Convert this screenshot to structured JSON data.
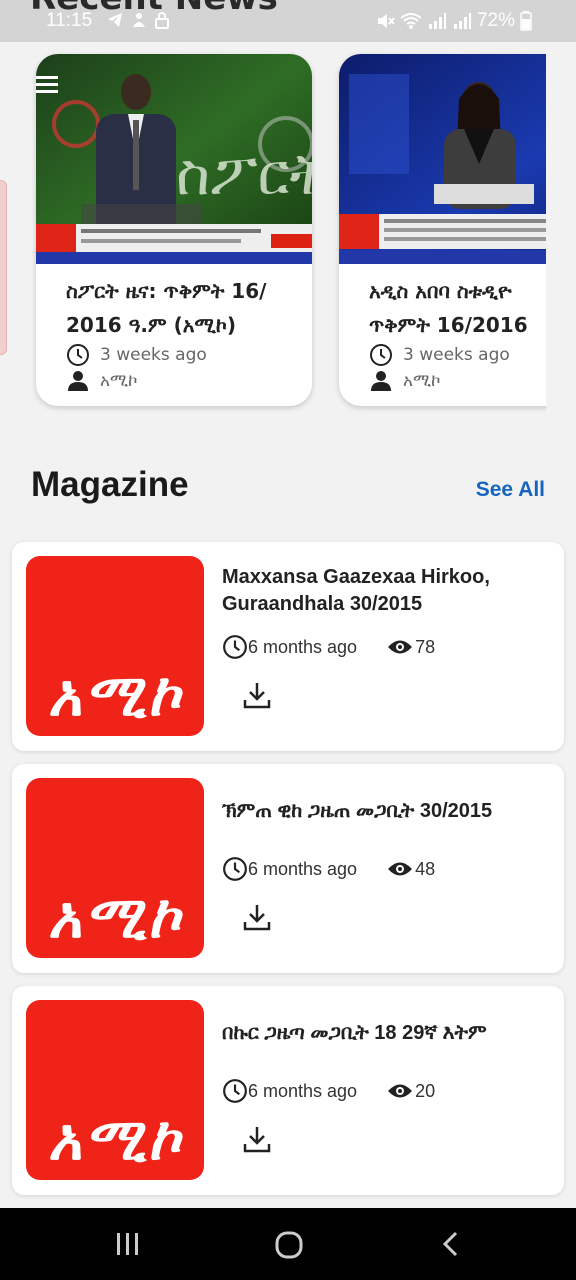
{
  "status_bar": {
    "time": "11:15",
    "battery": "72%",
    "background_title": "Recent News"
  },
  "recent_news": [
    {
      "title": "ስፖርት ዜና: ጥቅምት 16/\n2016 ዓ.ም (አሚኮ)",
      "time_ago": "3 weeks ago",
      "author": "አሚኮ",
      "thumb_label": "ስፖርት"
    },
    {
      "title": "አዲስ አበባ ስቱዲዮ\nጥቅምት 16/2016",
      "time_ago": "3 weeks ago",
      "author": "አሚኮ"
    }
  ],
  "magazine": {
    "title": "Magazine",
    "see_all": "See All",
    "items": [
      {
        "title": "Maxxansa Gaazexaa Hirkoo, Guraandhala 30/2015",
        "time_ago": "6 months ago",
        "views": "78",
        "logo_text": "አሚኮ"
      },
      {
        "title": "ኽምጠ ዊከ ጋዜጠ መጋቢት 30/2015",
        "time_ago": "6 months ago",
        "views": "48",
        "logo_text": "አሚኮ"
      },
      {
        "title": "በኩር ጋዜጣ መጋቢት 18 29ኛ እትም",
        "time_ago": "6 months ago",
        "views": "20",
        "logo_text": "አሚኮ"
      }
    ]
  },
  "colors": {
    "accent": "#1565c0",
    "brand_red": "#ef2318"
  },
  "icons": [
    "menu-icon",
    "clock-icon",
    "person-icon",
    "eye-icon",
    "download-icon",
    "recents-icon",
    "home-icon",
    "back-icon"
  ]
}
